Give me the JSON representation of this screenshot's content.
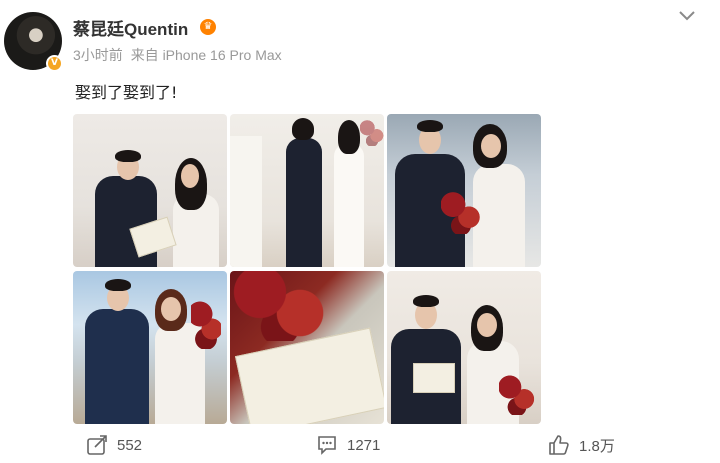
{
  "post": {
    "author": "蔡昆廷Quentin",
    "time": "3小时前",
    "source": "来自 iPhone 16 Pro Max",
    "text": "娶到了娶到了!",
    "photos": [
      {
        "name": "photo-1"
      },
      {
        "name": "photo-2"
      },
      {
        "name": "photo-3"
      },
      {
        "name": "photo-4"
      },
      {
        "name": "photo-5"
      },
      {
        "name": "photo-6"
      }
    ]
  },
  "actions": {
    "share_count": "552",
    "comment_count": "1271",
    "like_count": "1.8万"
  },
  "colors": {
    "accent": "#ff8200",
    "meta_text": "#999999",
    "verified_badge": "#f5a623"
  },
  "icons": {
    "expand": "chevron-down-icon",
    "share": "share-icon",
    "comment": "comment-icon",
    "like": "thumbs-up-icon",
    "member": "crown-icon",
    "verified": "verified-badge-icon"
  }
}
